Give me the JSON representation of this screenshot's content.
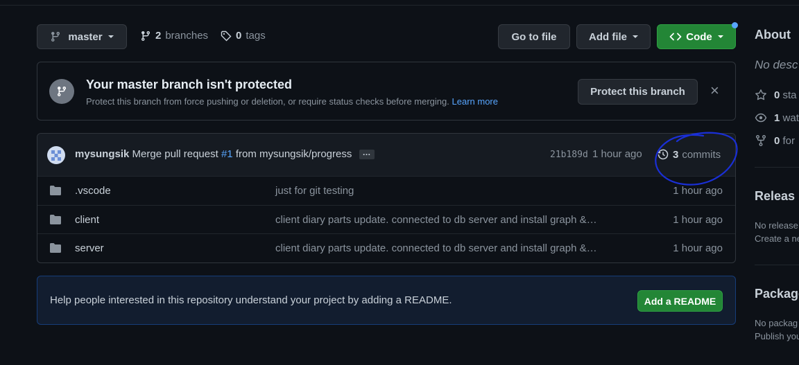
{
  "toolbar": {
    "branch_name": "master",
    "branch_count": "2",
    "branch_word": "branches",
    "tag_count": "0",
    "tag_word": "tags",
    "go_to_file": "Go to file",
    "add_file": "Add file",
    "code": "Code"
  },
  "protect_banner": {
    "title": "Your master branch isn't protected",
    "description": "Protect this branch from force pushing or deletion, or require status checks before merging.",
    "learn_more": "Learn more",
    "button": "Protect this branch",
    "close": "×"
  },
  "commit": {
    "author": "mysungsik",
    "message_prefix": "Merge pull request",
    "pr_number": "#1",
    "message_suffix": "from mysungsik/progress",
    "ellipsis": "…",
    "sha": "21b189d",
    "time": "1 hour ago",
    "commit_count": "3",
    "commit_word": "commits"
  },
  "files": [
    {
      "name": ".vscode",
      "message": "just for git testing",
      "age": "1 hour ago"
    },
    {
      "name": "client",
      "message": "client diary parts update. connected to db server and install graph &…",
      "age": "1 hour ago"
    },
    {
      "name": "server",
      "message": "client diary parts update. connected to db server and install graph &…",
      "age": "1 hour ago"
    }
  ],
  "readme": {
    "text": "Help people interested in this repository understand your project by adding a README.",
    "button": "Add a README"
  },
  "sidebar": {
    "about": "About",
    "no_description": "No desc",
    "stars": "0",
    "stars_word": "sta",
    "watchers": "1",
    "watchers_word": "wat",
    "forks": "0",
    "forks_word": "for",
    "releases": "Releas",
    "no_releases": "No release",
    "create_release": "Create a ne",
    "packages": "Package",
    "no_packages": "No packag",
    "publish": "Publish you"
  },
  "colors": {
    "background": "#0d1117",
    "green": "#238636",
    "link": "#58a6ff",
    "annotation": "#1a2fd6"
  }
}
